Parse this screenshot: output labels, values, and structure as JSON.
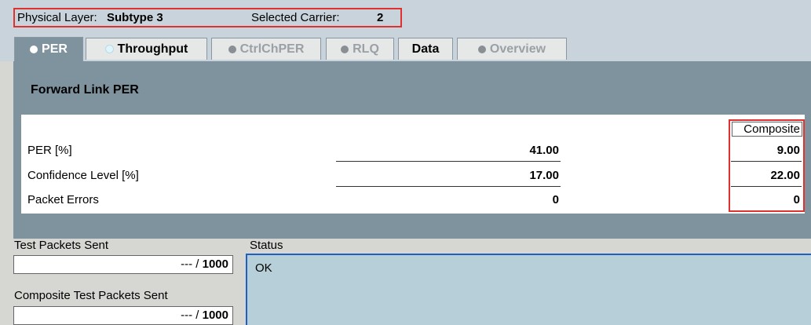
{
  "header": {
    "physical_layer_label": "Physical Layer:",
    "physical_layer_value": "Subtype 3",
    "selected_carrier_label": "Selected Carrier:",
    "selected_carrier_value": "2"
  },
  "tabs": [
    {
      "label": "PER",
      "state": "active",
      "dot": "white"
    },
    {
      "label": "Throughput",
      "state": "enabled",
      "dot": "cyan"
    },
    {
      "label": "CtrlChPER",
      "state": "disabled",
      "dot": "grey"
    },
    {
      "label": "RLQ",
      "state": "disabled",
      "dot": "grey"
    },
    {
      "label": "Data",
      "state": "enabled",
      "dot": "none"
    },
    {
      "label": "Overview",
      "state": "disabled",
      "dot": "grey"
    }
  ],
  "panel": {
    "title": "Forward Link PER",
    "composite_header": "Composite",
    "rows": [
      {
        "label": "PER [%]",
        "value": "41.00",
        "composite": "9.00"
      },
      {
        "label": "Confidence Level [%]",
        "value": "17.00",
        "composite": "22.00"
      },
      {
        "label": "Packet Errors",
        "value": "0",
        "composite": "0"
      }
    ]
  },
  "bottom": {
    "test_packets_label": "Test Packets Sent",
    "test_packets_value_prefix": "--- / ",
    "test_packets_value_total": "1000",
    "composite_packets_label": "Composite Test Packets Sent",
    "composite_packets_value_prefix": "--- / ",
    "composite_packets_value_total": "1000",
    "status_label": "Status",
    "status_value": "OK"
  },
  "colors": {
    "background": "#d6d6d3",
    "header_bar": "#c9d3dc",
    "panel": "#7f939f",
    "highlight_red": "#e03030",
    "status_bg": "#b7cfd9",
    "status_border": "#1f5fbf"
  }
}
